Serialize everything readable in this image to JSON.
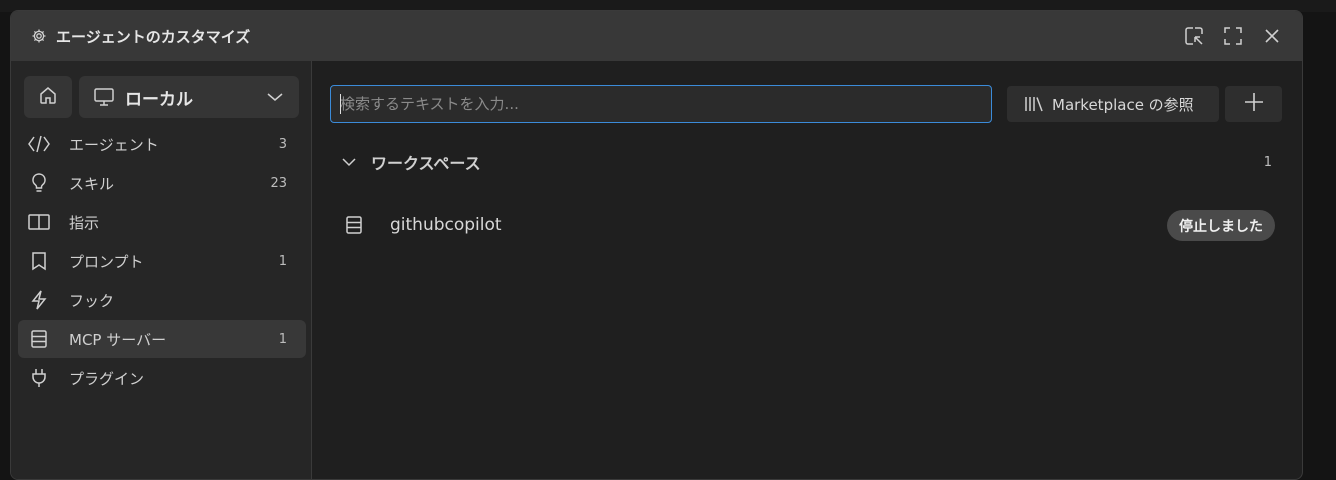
{
  "window": {
    "title": "エージェントのカスタマイズ",
    "title_icon": "gear-icon",
    "actions": [
      "open-in-window-icon",
      "maximize-icon",
      "close-icon"
    ]
  },
  "sidebar": {
    "scope": {
      "label": "ローカル",
      "icon": "monitor-icon"
    },
    "items": [
      {
        "label": "エージェント",
        "count": "3",
        "icon": "code-icon"
      },
      {
        "label": "スキル",
        "count": "23",
        "icon": "lightbulb-icon"
      },
      {
        "label": "指示",
        "count": "",
        "icon": "book-icon"
      },
      {
        "label": "プロンプト",
        "count": "1",
        "icon": "bookmark-icon"
      },
      {
        "label": "フック",
        "count": "",
        "icon": "lightning-icon"
      },
      {
        "label": "MCP サーバー",
        "count": "1",
        "icon": "server-icon",
        "active": true
      },
      {
        "label": "プラグイン",
        "count": "",
        "icon": "plug-icon"
      }
    ]
  },
  "main": {
    "search": {
      "placeholder": "検索するテキストを入力...",
      "value": ""
    },
    "marketplace_label": "Marketplace の参照",
    "section": {
      "title": "ワークスペース",
      "count": "1"
    },
    "servers": [
      {
        "name": "githubcopilot",
        "status": "停止しました",
        "icon": "server-icon"
      }
    ]
  },
  "colors": {
    "accent": "#3b8bd9",
    "window_bg": "#1f1f1f",
    "titlebar_bg": "#383838",
    "sidebar_bg": "#262626"
  }
}
